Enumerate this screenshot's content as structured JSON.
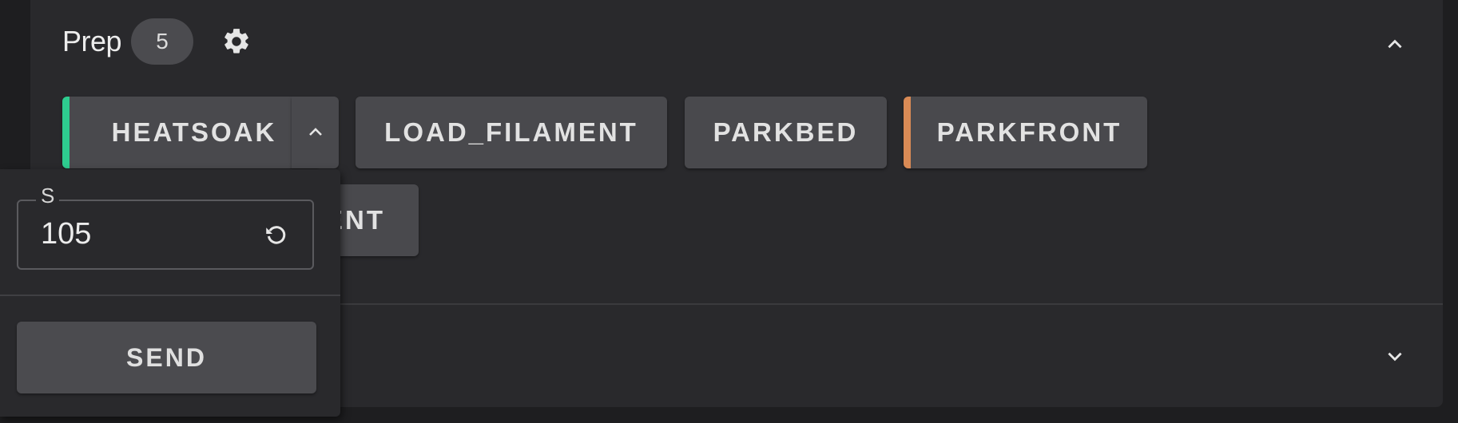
{
  "section": {
    "title": "Prep",
    "count": "5"
  },
  "macros": [
    {
      "label": "HEATSOAK",
      "accent": "#2ecc8f"
    },
    {
      "label": "LOAD_FILAMENT"
    },
    {
      "label": "PARKBED"
    },
    {
      "label": "PARKFRONT",
      "accent": "#d98a55"
    },
    {
      "label": "ENT"
    }
  ],
  "popup": {
    "param_label": "S",
    "param_value": "105",
    "send_label": "SEND"
  },
  "icons": {
    "settings": "gear-icon",
    "collapse": "chevron-up-icon",
    "expand": "chevron-down-icon",
    "reset": "reset-icon"
  }
}
